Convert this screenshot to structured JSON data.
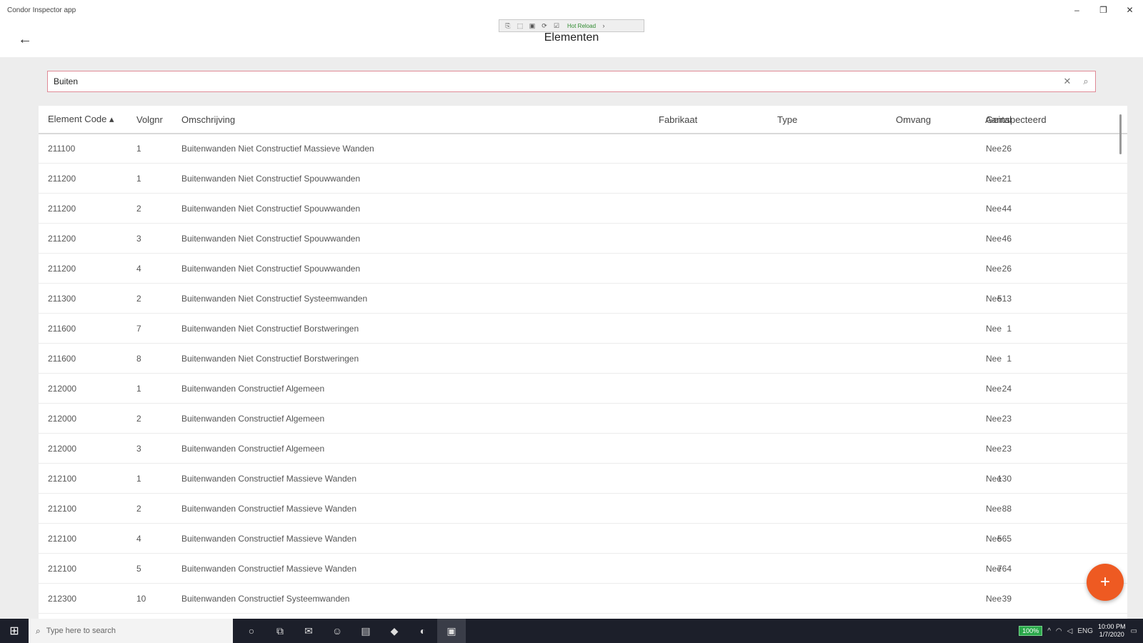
{
  "window": {
    "title": "Condor Inspector app",
    "controls": {
      "minimize": "–",
      "restore": "❐",
      "close": "✕"
    }
  },
  "header": {
    "back_icon": "arrow-left-icon",
    "back_glyph": "←",
    "title": "Elementen"
  },
  "debug_toolbar": {
    "icons": [
      "⎘",
      "⬚",
      "▣",
      "⟳",
      "☑"
    ],
    "hot_reload_label": "Hot Reload",
    "arrow": "›"
  },
  "search": {
    "value": "Buiten",
    "placeholder": "",
    "clear_glyph": "✕",
    "search_glyph": "⌕"
  },
  "table": {
    "columns": {
      "code": "Element Code ▴",
      "volgnr": "Volgnr",
      "omschrijving": "Omschrijving",
      "fabrikaat": "Fabrikaat",
      "type": "Type",
      "omvang": "Omvang",
      "aantal": "Aantal",
      "geinspecteerd": "Geinspecteerd"
    },
    "rows": [
      {
        "code": "211100",
        "volgnr": "1",
        "omschrijving": "Buitenwanden Niet Constructief Massieve Wanden",
        "aantal": "26",
        "geinspecteerd": "Nee"
      },
      {
        "code": "211200",
        "volgnr": "1",
        "omschrijving": "Buitenwanden Niet Constructief Spouwwanden",
        "aantal": "21",
        "geinspecteerd": "Nee"
      },
      {
        "code": "211200",
        "volgnr": "2",
        "omschrijving": "Buitenwanden Niet Constructief Spouwwanden",
        "aantal": "44",
        "geinspecteerd": "Nee"
      },
      {
        "code": "211200",
        "volgnr": "3",
        "omschrijving": "Buitenwanden Niet Constructief Spouwwanden",
        "aantal": "46",
        "geinspecteerd": "Nee"
      },
      {
        "code": "211200",
        "volgnr": "4",
        "omschrijving": "Buitenwanden Niet Constructief Spouwwanden",
        "aantal": "26",
        "geinspecteerd": "Nee"
      },
      {
        "code": "211300",
        "volgnr": "2",
        "omschrijving": "Buitenwanden Niet Constructief Systeemwanden",
        "aantal": "513",
        "geinspecteerd": "Nee"
      },
      {
        "code": "211600",
        "volgnr": "7",
        "omschrijving": "Buitenwanden Niet Constructief Borstweringen",
        "aantal": "1",
        "geinspecteerd": "Nee"
      },
      {
        "code": "211600",
        "volgnr": "8",
        "omschrijving": "Buitenwanden Niet Constructief Borstweringen",
        "aantal": "1",
        "geinspecteerd": "Nee"
      },
      {
        "code": "212000",
        "volgnr": "1",
        "omschrijving": "Buitenwanden Constructief Algemeen",
        "aantal": "24",
        "geinspecteerd": "Nee"
      },
      {
        "code": "212000",
        "volgnr": "2",
        "omschrijving": "Buitenwanden Constructief Algemeen",
        "aantal": "23",
        "geinspecteerd": "Nee"
      },
      {
        "code": "212000",
        "volgnr": "3",
        "omschrijving": "Buitenwanden Constructief Algemeen",
        "aantal": "23",
        "geinspecteerd": "Nee"
      },
      {
        "code": "212100",
        "volgnr": "1",
        "omschrijving": "Buitenwanden Constructief Massieve Wanden",
        "aantal": "130",
        "geinspecteerd": "Nee"
      },
      {
        "code": "212100",
        "volgnr": "2",
        "omschrijving": "Buitenwanden Constructief Massieve Wanden",
        "aantal": "88",
        "geinspecteerd": "Nee"
      },
      {
        "code": "212100",
        "volgnr": "4",
        "omschrijving": "Buitenwanden Constructief Massieve Wanden",
        "aantal": "565",
        "geinspecteerd": "Nee"
      },
      {
        "code": "212100",
        "volgnr": "5",
        "omschrijving": "Buitenwanden Constructief Massieve Wanden",
        "aantal": "764",
        "geinspecteerd": "Nee"
      },
      {
        "code": "212300",
        "volgnr": "10",
        "omschrijving": "Buitenwanden Constructief Systeemwanden",
        "aantal": "39",
        "geinspecteerd": "Nee"
      }
    ]
  },
  "fab": {
    "glyph": "+",
    "icon": "plus-icon",
    "color": "#ee5a22"
  },
  "taskbar": {
    "start_glyph": "⊞",
    "search_placeholder": "Type here to search",
    "search_glyph": "⌕",
    "apps": [
      {
        "name": "cortana-icon",
        "glyph": "○"
      },
      {
        "name": "task-view-icon",
        "glyph": "⧉"
      },
      {
        "name": "outlook-icon",
        "glyph": "✉"
      },
      {
        "name": "teams-icon",
        "glyph": "☺"
      },
      {
        "name": "file-explorer-icon",
        "glyph": "▤"
      },
      {
        "name": "visual-studio-icon",
        "glyph": "◆"
      },
      {
        "name": "edge-icon",
        "glyph": "◐"
      },
      {
        "name": "condor-app-icon",
        "glyph": "▣"
      }
    ],
    "tray": {
      "battery": "100%",
      "lang": "ENG",
      "time": "10:00 PM",
      "date": "1/7/2020"
    }
  }
}
